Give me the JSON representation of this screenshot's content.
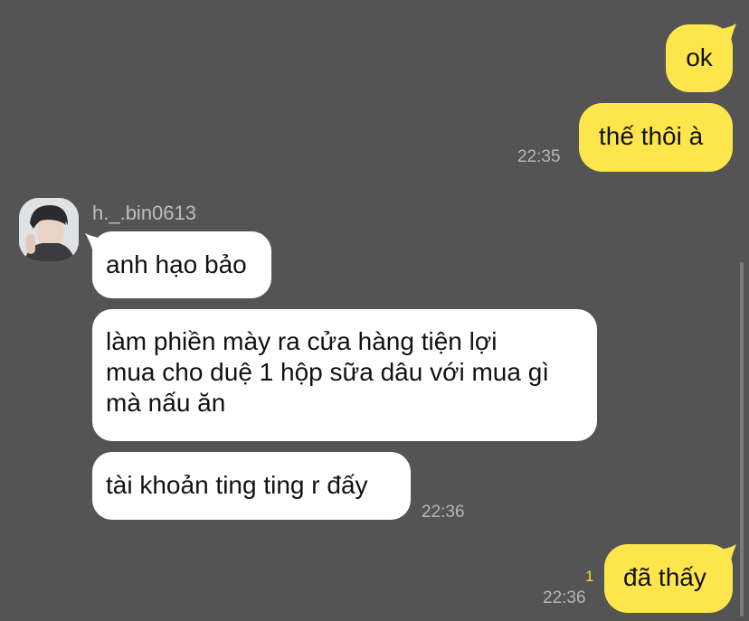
{
  "chat": {
    "messages_out_1": {
      "text": "ok"
    },
    "messages_out_2": {
      "text": "thế thôi à",
      "time": "22:35"
    },
    "sender": {
      "name": "h._.bin0613"
    },
    "messages_in": [
      {
        "text": "anh hạo bảo"
      },
      {
        "lines": [
          "làm phiền mày ra cửa hàng tiện lợi",
          "mua cho duệ 1 hộp sữa dâu với mua gì",
          "mà nấu ăn"
        ]
      },
      {
        "text": "tài khoản ting ting r đấy",
        "time": "22:36"
      }
    ],
    "messages_out_3": {
      "text": "đã thấy",
      "time": "22:36",
      "unread_count": "1"
    }
  },
  "colors": {
    "background": "#545454",
    "outgoing_bubble": "#FDE64B",
    "incoming_bubble": "#FFFFFF",
    "timestamp": "#B6B6B6",
    "unread_indicator": "#F5D93A"
  },
  "icons": {
    "avatar": "profile-photo"
  }
}
